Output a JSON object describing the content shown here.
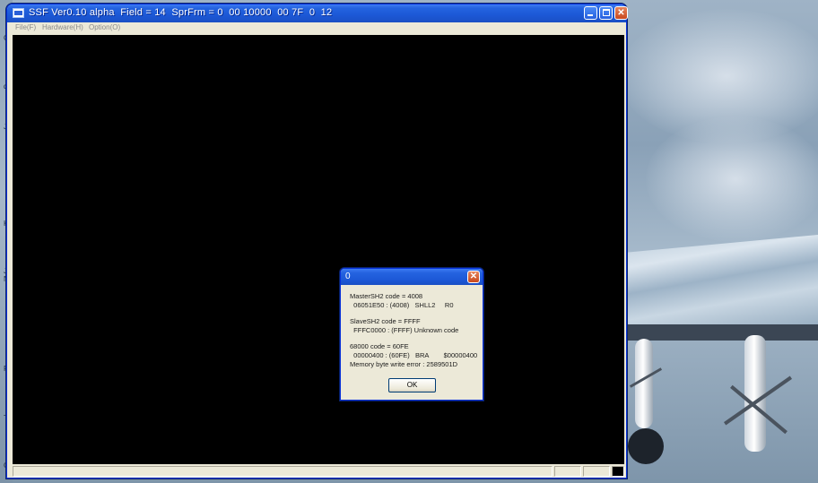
{
  "window": {
    "title": "SSF Ver0.10 alpha  Field = 14  SprFrm = 0  00 10000  00 7F  0  12",
    "minimize_label": "",
    "maximize_label": "",
    "close_label": "✕"
  },
  "menu": {
    "items": [
      {
        "label": "File(F)"
      },
      {
        "label": "Hardware(H)"
      },
      {
        "label": "Option(O)"
      }
    ]
  },
  "dialog": {
    "title": "0",
    "close_label": "✕",
    "lines": [
      "MasterSH2 code = 4008",
      "  06051E50 : (4008)   SHLL2     R0",
      "",
      "SlaveSH2 code = FFFF",
      "  FFFC0000 : (FFFF) Unknown code",
      "",
      "68000 code = 60FE",
      "  00000400 : (60FE)   BRA        $00000400",
      "Memory byte write error : 2589501D"
    ],
    "ok_label": "OK"
  },
  "desktop": {
    "left_strip_glyphs": [
      "G",
      "do",
      "J",
      "K",
      "J",
      "N",
      "R",
      "Te",
      "Gi"
    ]
  },
  "colors": {
    "titlebar": "#2463e0",
    "window_face": "#ece9d8",
    "screen": "#000000"
  }
}
